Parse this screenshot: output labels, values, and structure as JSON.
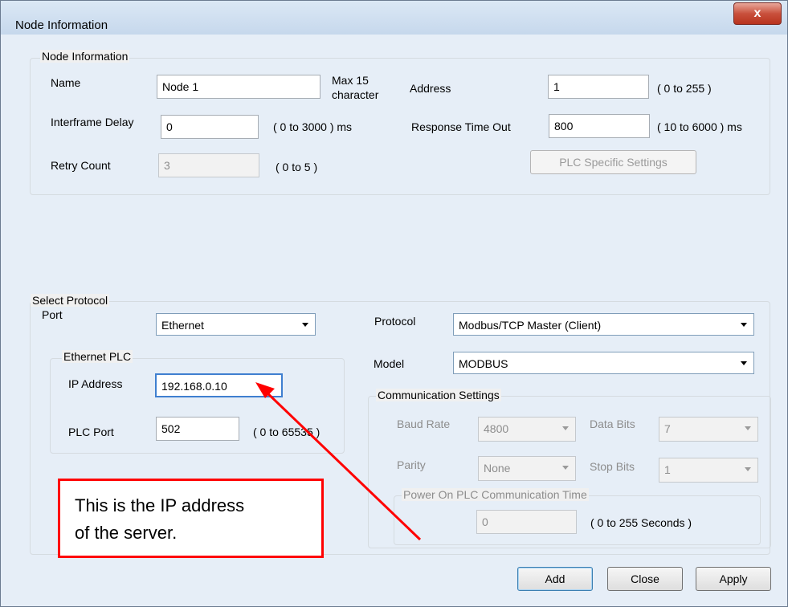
{
  "window": {
    "title": "Node Information",
    "close_glyph": "x"
  },
  "node_info": {
    "legend": "Node Information",
    "name_label": "Name",
    "name_value": "Node 1",
    "name_hint_line1": "Max 15",
    "name_hint_line2": "character",
    "address_label": "Address",
    "address_value": "1",
    "address_range": "( 0 to 255 )",
    "interframe_label": "Interframe Delay",
    "interframe_value": "0",
    "interframe_range": "( 0 to 3000 ) ms",
    "response_label": "Response Time Out",
    "response_value": "800",
    "response_range": "( 10 to 6000 ) ms",
    "retry_label": "Retry Count",
    "retry_value": "3",
    "retry_range": "( 0 to 5 )",
    "plc_settings_button": "PLC Specific Settings"
  },
  "protocol": {
    "legend": "Select Protocol",
    "port_label": "Port",
    "port_value": "Ethernet",
    "protocol_label": "Protocol",
    "protocol_value": "Modbus/TCP Master (Client)",
    "model_label": "Model",
    "model_value": "MODBUS",
    "ethernet_legend": "Ethernet PLC",
    "ip_label": "IP Address",
    "ip_value": "192.168.0.10",
    "plc_port_label": "PLC Port",
    "plc_port_value": "502",
    "plc_port_range": "( 0 to 65535 )"
  },
  "comm": {
    "legend": "Communication Settings",
    "baud_label": "Baud Rate",
    "baud_value": "4800",
    "data_bits_label": "Data Bits",
    "data_bits_value": "7",
    "parity_label": "Parity",
    "parity_value": "None",
    "stop_bits_label": "Stop Bits",
    "stop_bits_value": "1",
    "power_legend": "Power On PLC Communication Time",
    "power_value": "0",
    "power_range": "( 0 to 255 Seconds )"
  },
  "buttons": {
    "add": "Add",
    "close": "Close",
    "apply": "Apply"
  },
  "annotation": {
    "line1": "This is the IP address",
    "line2": "of the server.",
    "color": "#ff0000"
  }
}
